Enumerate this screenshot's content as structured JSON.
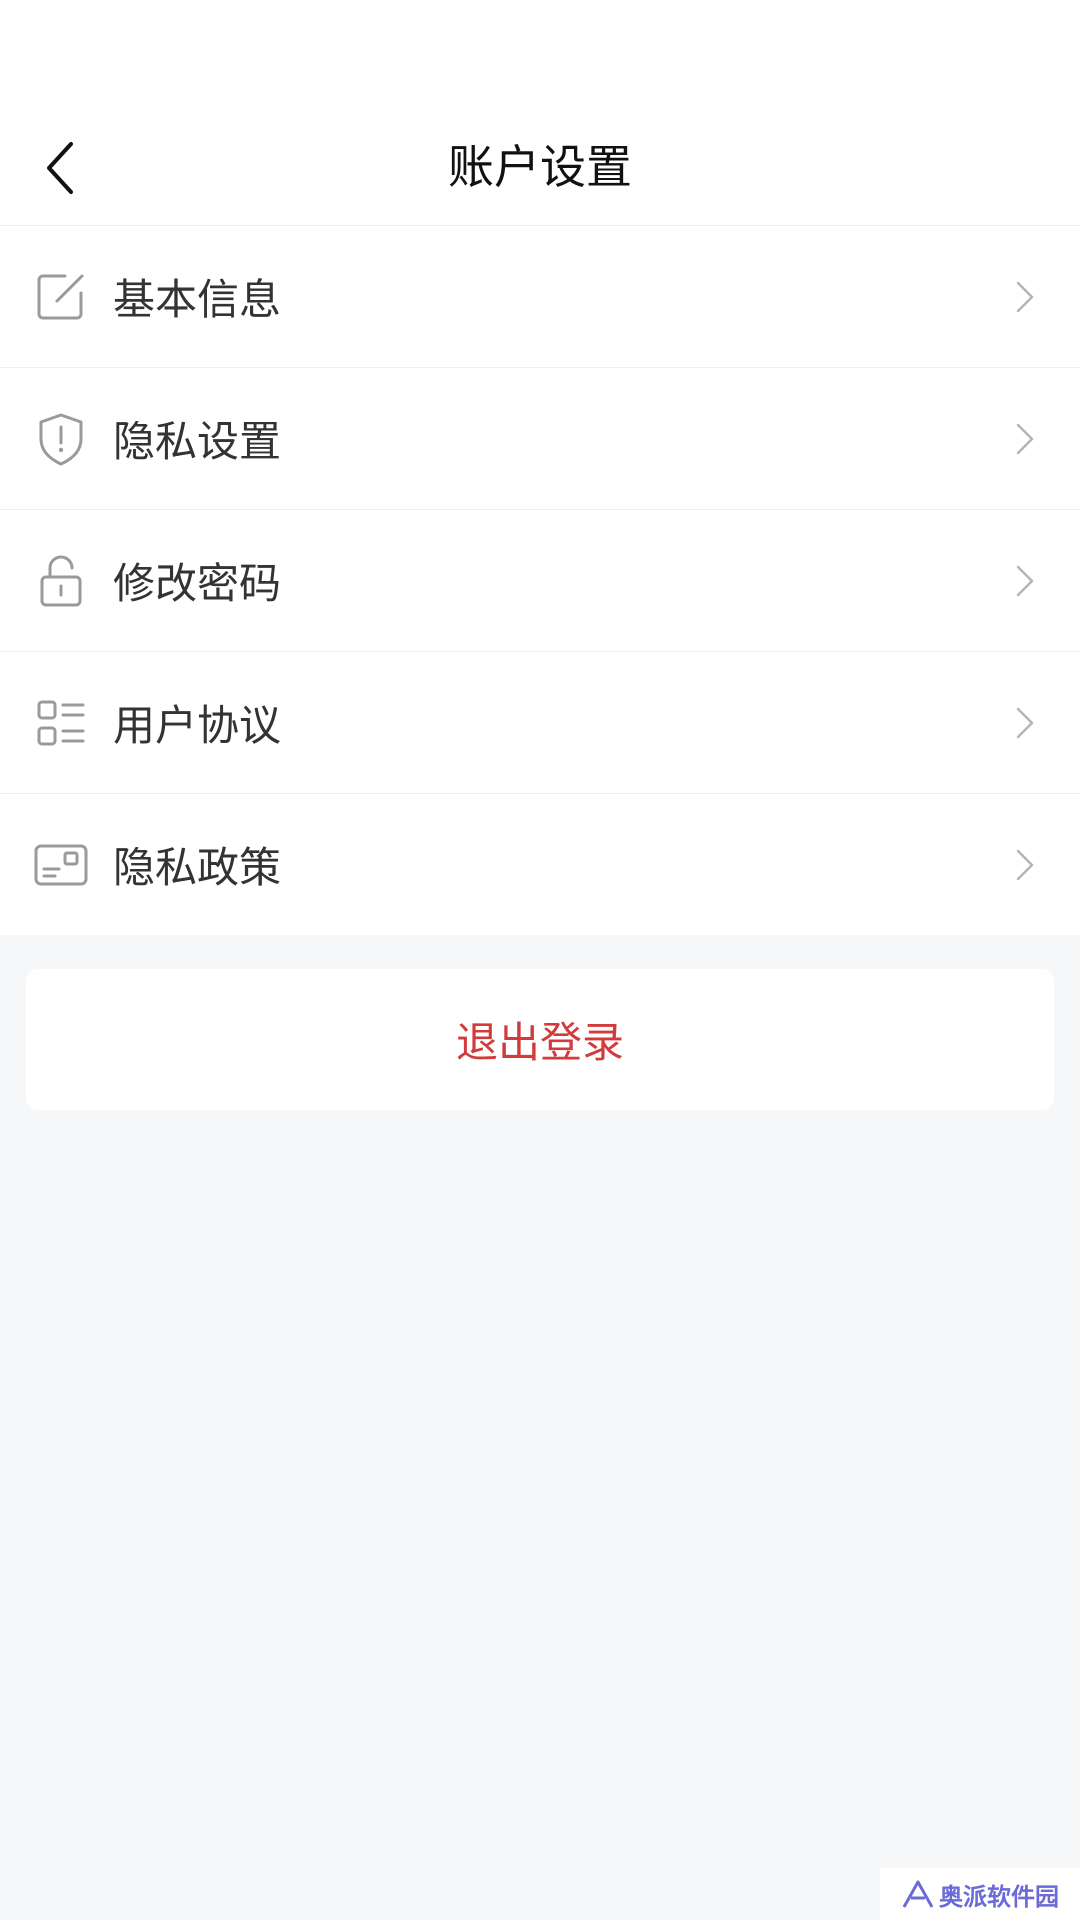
{
  "header": {
    "title": "账户设置"
  },
  "menu": {
    "items": [
      {
        "label": "基本信息",
        "icon": "edit-icon"
      },
      {
        "label": "隐私设置",
        "icon": "shield-alert-icon"
      },
      {
        "label": "修改密码",
        "icon": "lock-icon"
      },
      {
        "label": "用户协议",
        "icon": "list-icon"
      },
      {
        "label": "隐私政策",
        "icon": "id-card-icon"
      }
    ]
  },
  "logout": {
    "label": "退出登录"
  },
  "watermark": {
    "text": "奥派软件园"
  },
  "colors": {
    "background": "#f6f7f9",
    "surface": "#ffffff",
    "text": "#333333",
    "icon": "#9a9a9a",
    "danger": "#d23b3b"
  }
}
